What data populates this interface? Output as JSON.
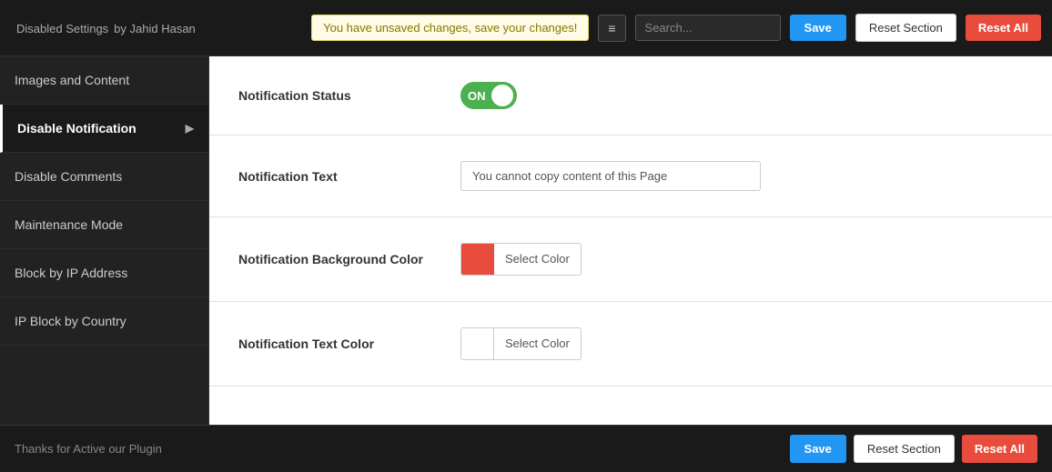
{
  "header": {
    "title": "Disabled Settings",
    "subtitle": "by Jahid Hasan",
    "unsaved_notice": "You have unsaved changes, save your changes!",
    "search_placeholder": "Search...",
    "save_label": "Save",
    "reset_section_label": "Reset Section",
    "reset_all_label": "Reset All",
    "menu_icon": "≡"
  },
  "sidebar": {
    "items": [
      {
        "id": "images-content",
        "label": "Images and Content",
        "active": false
      },
      {
        "id": "disable-notification",
        "label": "Disable Notification",
        "active": true
      },
      {
        "id": "disable-comments",
        "label": "Disable Comments",
        "active": false
      },
      {
        "id": "maintenance-mode",
        "label": "Maintenance Mode",
        "active": false
      },
      {
        "id": "block-by-ip",
        "label": "Block by IP Address",
        "active": false
      },
      {
        "id": "ip-block-country",
        "label": "IP Block by Country",
        "active": false
      }
    ]
  },
  "main": {
    "sections": [
      {
        "id": "notification-status",
        "label": "Notification Status",
        "type": "toggle",
        "value": "ON"
      },
      {
        "id": "notification-text",
        "label": "Notification Text",
        "type": "text",
        "value": "You cannot copy content of this Page",
        "placeholder": "You cannot copy content of this Page"
      },
      {
        "id": "notification-bg-color",
        "label": "Notification Background Color",
        "type": "color",
        "color": "#e74c3c",
        "button_label": "Select Color"
      },
      {
        "id": "notification-text-color",
        "label": "Notification Text Color",
        "type": "color",
        "color": "#ffffff",
        "button_label": "Select Color"
      }
    ]
  },
  "footer": {
    "text": "Thanks for Active our Plugin",
    "save_label": "Save",
    "reset_section_label": "Reset Section",
    "reset_all_label": "Reset All"
  }
}
